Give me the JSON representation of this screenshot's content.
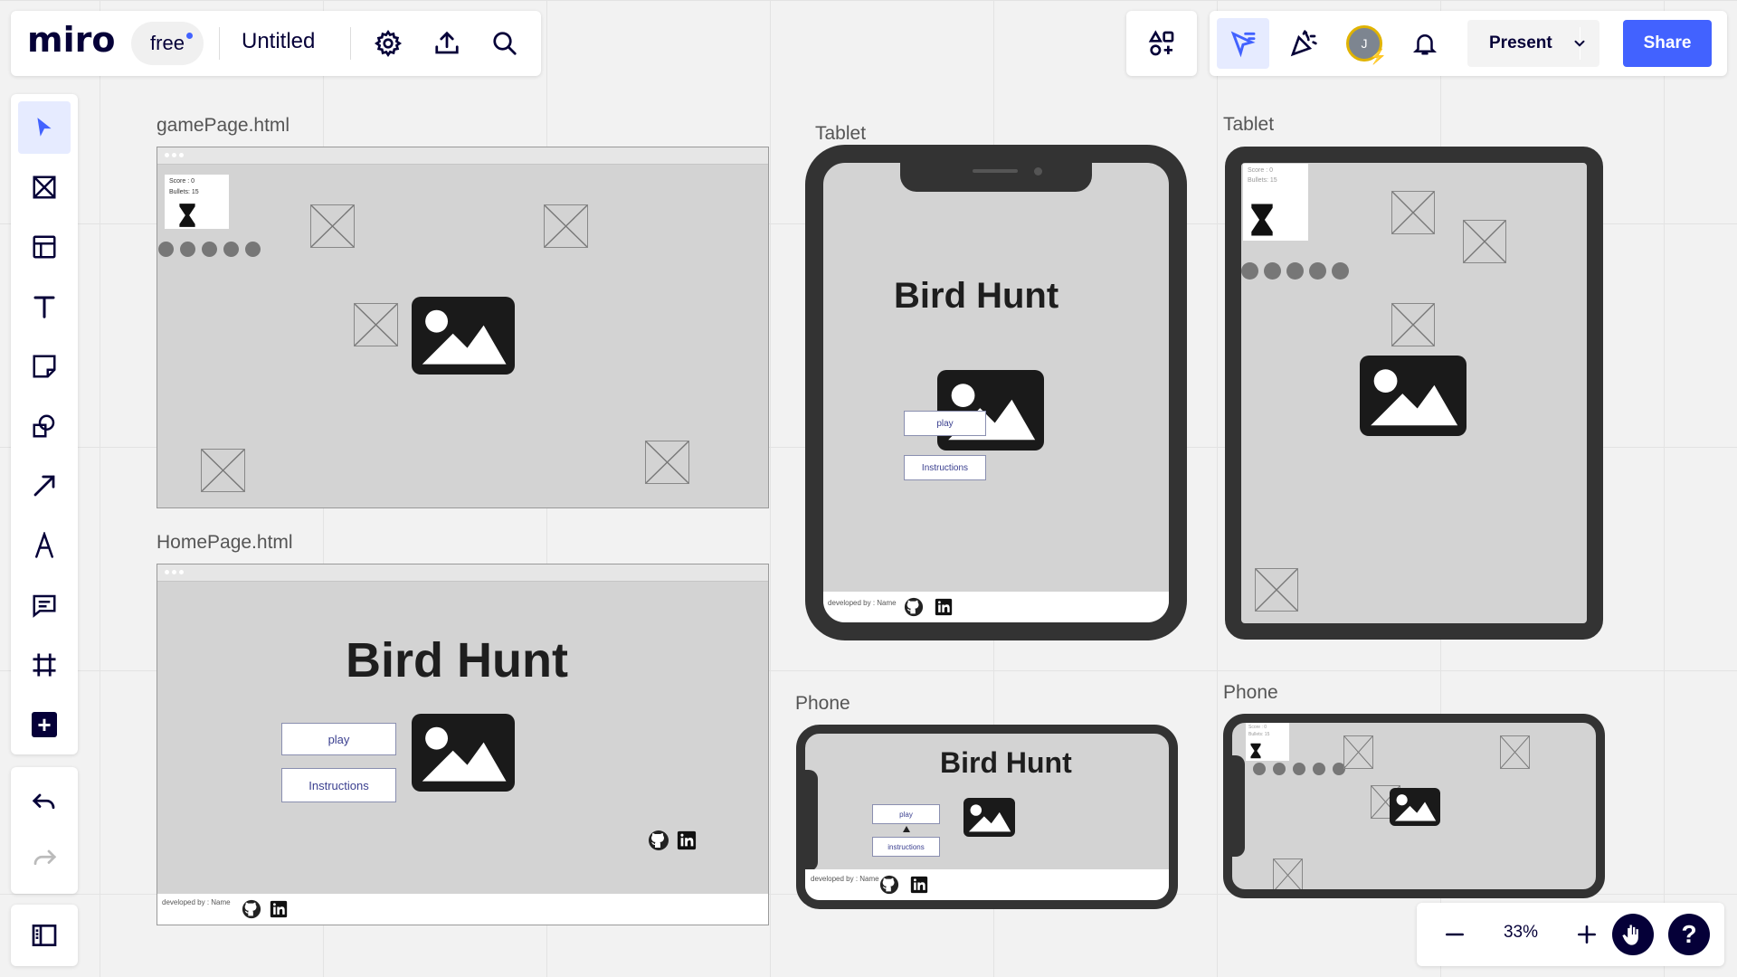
{
  "app": {
    "logo": "miro",
    "plan": "free",
    "board_title": "Untitled"
  },
  "header_right": {
    "avatar_initial": "J",
    "present_label": "Present",
    "share_label": "Share"
  },
  "zoom": {
    "level": "33%"
  },
  "frames": {
    "game_desktop": {
      "label": "gamePage.html",
      "score": "Score : 0",
      "bullets": "Bullets: 15"
    },
    "home_desktop": {
      "label": "HomePage.html",
      "title": "Bird Hunt",
      "play": "play",
      "instructions": "Instructions",
      "developed_by": "developed by : Name"
    },
    "home_tablet": {
      "label": "Tablet",
      "title": "Bird Hunt",
      "play": "play",
      "instructions": "Instructions",
      "developed_by": "developed by : Name"
    },
    "game_tablet": {
      "label": "Tablet",
      "score": "Score : 0",
      "bullets": "Bullets: 15"
    },
    "home_phone": {
      "label": "Phone",
      "title": "Bird Hunt",
      "play": "play",
      "instructions": "instructions",
      "developed_by": "developed by : Name"
    },
    "game_phone": {
      "label": "Phone",
      "score": "Score : 0",
      "bullets": "Bullets: 15"
    }
  },
  "colors": {
    "accent": "#4262ff",
    "ink": "#050038",
    "wire_fill": "#d3d3d3",
    "device_frame": "#333333"
  }
}
